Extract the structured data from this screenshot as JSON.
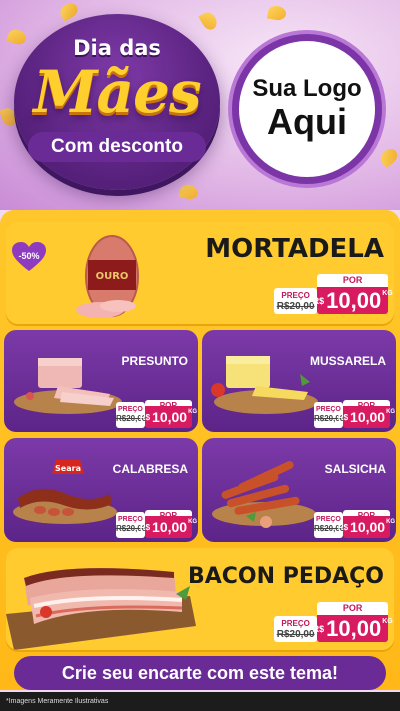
{
  "header": {
    "title_top": "Dia das",
    "title_main": "Mães",
    "title_sub": "Com desconto",
    "logo_line1": "Sua Logo",
    "logo_line2": "Aqui"
  },
  "featured": [
    {
      "name": "MORTADELA",
      "discount": "-50%",
      "price": {
        "label": "PREÇO",
        "old": "R$20,00",
        "por": "POR",
        "currency": "R$",
        "value": "10,00",
        "unit": "KG"
      }
    },
    {
      "name": "BACON PEDAÇO",
      "price": {
        "label": "PREÇO",
        "old": "R$20,00",
        "por": "POR",
        "currency": "R$",
        "value": "10,00",
        "unit": "KG"
      }
    }
  ],
  "products": [
    {
      "name": "PRESUNTO",
      "price": {
        "label": "PREÇO",
        "old": "R$20,00",
        "por": "POR",
        "currency": "R$",
        "value": "10,00",
        "unit": "KG"
      }
    },
    {
      "name": "MUSSARELA",
      "price": {
        "label": "PREÇO",
        "old": "R$20,00",
        "por": "POR",
        "currency": "R$",
        "value": "10,00",
        "unit": "KG"
      }
    },
    {
      "name": "CALABRESA",
      "brand": "Seara",
      "price": {
        "label": "PREÇO",
        "old": "R$20,00",
        "por": "POR",
        "currency": "R$",
        "value": "10,00",
        "unit": "KG"
      }
    },
    {
      "name": "SALSICHA",
      "price": {
        "label": "PREÇO",
        "old": "R$20,00",
        "por": "POR",
        "currency": "R$",
        "value": "10,00",
        "unit": "KG"
      }
    }
  ],
  "mortadela_brand": "OURO",
  "cta": "Crie seu encarte com este tema!",
  "footer_note": "*Imagens Meramente Ilustrativas",
  "colors": {
    "purple": "#6a2b97",
    "yellow": "#ffc72b",
    "pink": "#d81b60"
  }
}
